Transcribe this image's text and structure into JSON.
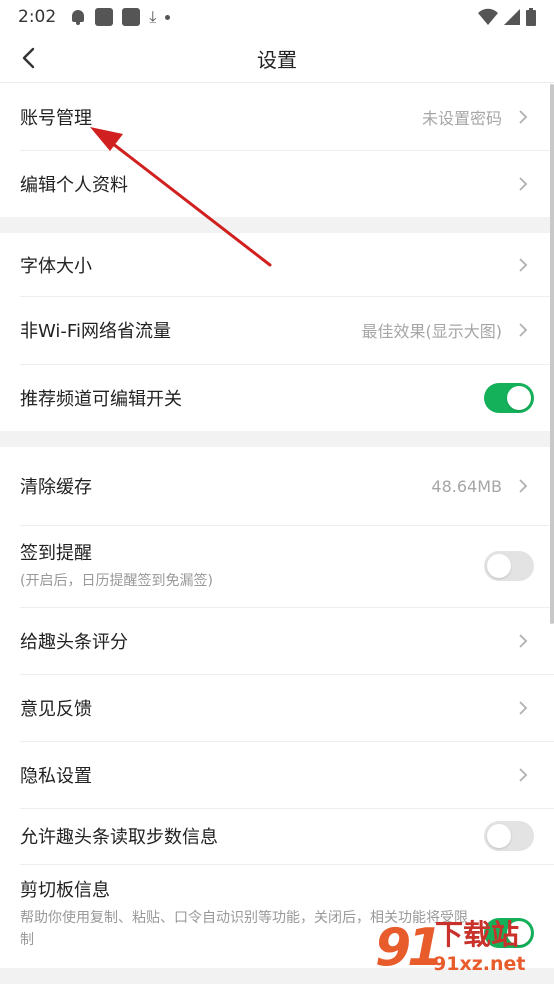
{
  "status_bar": {
    "time": "2:02"
  },
  "header": {
    "title": "设置"
  },
  "group1": {
    "account": {
      "label": "账号管理",
      "value": "未设置密码"
    },
    "edit_profile": {
      "label": "编辑个人资料"
    }
  },
  "group2": {
    "font_size": {
      "label": "字体大小"
    },
    "data_saver": {
      "label": "非Wi-Fi网络省流量",
      "value": "最佳效果(显示大图)"
    },
    "channel_edit": {
      "label": "推荐频道可编辑开关",
      "enabled": true
    }
  },
  "group3": {
    "clear_cache": {
      "label": "清除缓存",
      "value": "48.64MB"
    },
    "checkin": {
      "label": "签到提醒",
      "sub": "(开启后，日历提醒签到免漏签)",
      "enabled": false
    },
    "rate": {
      "label": "给趣头条评分"
    },
    "feedback": {
      "label": "意见反馈"
    },
    "privacy": {
      "label": "隐私设置"
    },
    "steps": {
      "label": "允许趣头条读取步数信息",
      "enabled": false
    },
    "clipboard": {
      "label": "剪切板信息",
      "sub": "帮助你使用复制、粘贴、口令自动识别等功能，关闭后，相关功能将受限制",
      "enabled": true
    }
  },
  "watermark": {
    "logo": "91",
    "text": "下载站",
    "domain": "91xz.net"
  },
  "colors": {
    "toggle_on": "#14b15a",
    "toggle_off": "#e3e3e3",
    "arrow": "#d0201f"
  }
}
